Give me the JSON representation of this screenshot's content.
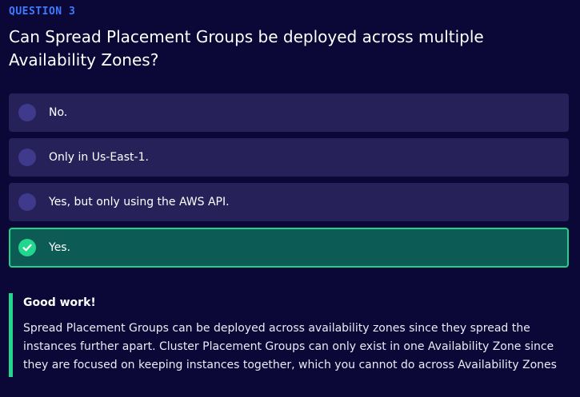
{
  "question": {
    "label": "QUESTION 3",
    "text": "Can Spread Placement Groups be deployed across multiple Availability Zones?"
  },
  "options": [
    {
      "text": "No.",
      "state": "unselected"
    },
    {
      "text": "Only in Us-East-1.",
      "state": "unselected"
    },
    {
      "text": "Yes, but only using the AWS API.",
      "state": "unselected"
    },
    {
      "text": "Yes.",
      "state": "correct",
      "icon": "check-icon"
    }
  ],
  "feedback": {
    "title": "Good work!",
    "body": "Spread Placement Groups can be deployed across availability zones since they spread the instances further apart. Cluster Placement Groups can only exist in one Availability Zone since they are focused on keeping instances together, which you cannot do across Availability Zones"
  },
  "colors": {
    "background": "#0b0736",
    "label_accent": "#3f7bff",
    "option_bg": "#272159",
    "radio": "#3f3a8c",
    "correct_bg": "#0c5c55",
    "correct_border": "#1fd18b",
    "success": "#22d68e"
  }
}
